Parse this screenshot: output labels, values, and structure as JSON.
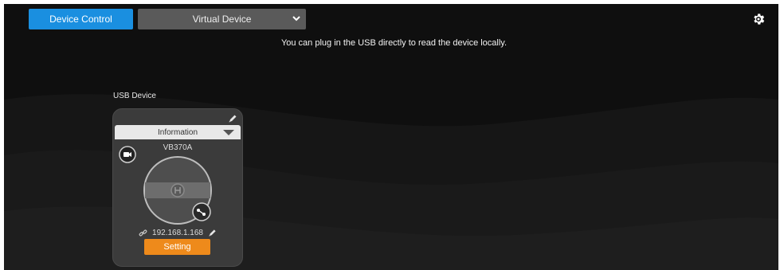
{
  "toolbar": {
    "device_control_label": "Device Control",
    "mode_select_value": "Virtual Device",
    "settings_icon": "gear-icon"
  },
  "hint": "You can plug in the USB directly to read the device locally.",
  "usb_section": {
    "label": "USB Device",
    "card": {
      "info_label": "Information",
      "device_name": "VB370A",
      "ip": "192.168.1.168",
      "setting_label": "Setting"
    }
  },
  "colors": {
    "accent_blue": "#1a8fe0",
    "accent_orange": "#ee8a1b",
    "background": "#0f0f0f"
  }
}
